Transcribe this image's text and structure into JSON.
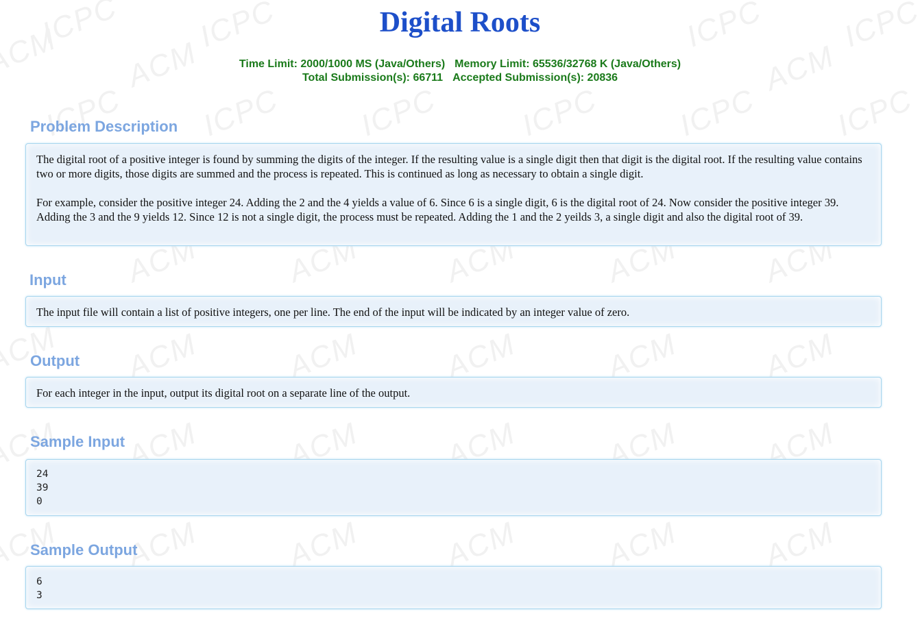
{
  "problem": {
    "title_above_cut": "Digital Roots",
    "title": "Digital Roots",
    "time_limit": "Time Limit: 2000/1000 MS (Java/Others)",
    "memory_limit": "Memory Limit: 65536/32768 K (Java/Others)",
    "total_submissions": "Total Submission(s): 66711",
    "accepted_submissions": "Accepted Submission(s): 20836"
  },
  "sections": {
    "description": {
      "heading": "Problem Description",
      "paragraphs": [
        "The digital root of a positive integer is found by summing the digits of the integer. If the resulting value is a single digit then that digit is the digital root. If the resulting value contains two or more digits, those digits are summed and the process is repeated. This is continued as long as necessary to obtain a single digit.",
        "For example, consider the positive integer 24. Adding the 2 and the 4 yields a value of 6. Since 6 is a single digit, 6 is the digital root of 24. Now consider the positive integer 39. Adding the 3 and the 9 yields 12. Since 12 is not a single digit, the process must be repeated. Adding the 1 and the 2 yeilds 3, a single digit and also the digital root of 39."
      ]
    },
    "input": {
      "heading": "Input",
      "text": "The input file will contain a list of positive integers, one per line. The end of the input will be indicated by an integer value of zero."
    },
    "output": {
      "heading": "Output",
      "text": "For each integer in the input, output its digital root on a separate line of the output."
    },
    "sample_input": {
      "heading": "Sample Input",
      "text": "24\n39\n0"
    },
    "sample_output": {
      "heading": "Sample Output",
      "text": "6\n3"
    }
  },
  "watermarks": {
    "acm": "ACM",
    "icpc": "ICPC"
  },
  "colors": {
    "title": "#1d4fc9",
    "limits": "#1a7a1a",
    "section_heading": "#7ca6e0",
    "panel_bg": "#e8f1fa",
    "panel_border": "#a8d6ee"
  }
}
